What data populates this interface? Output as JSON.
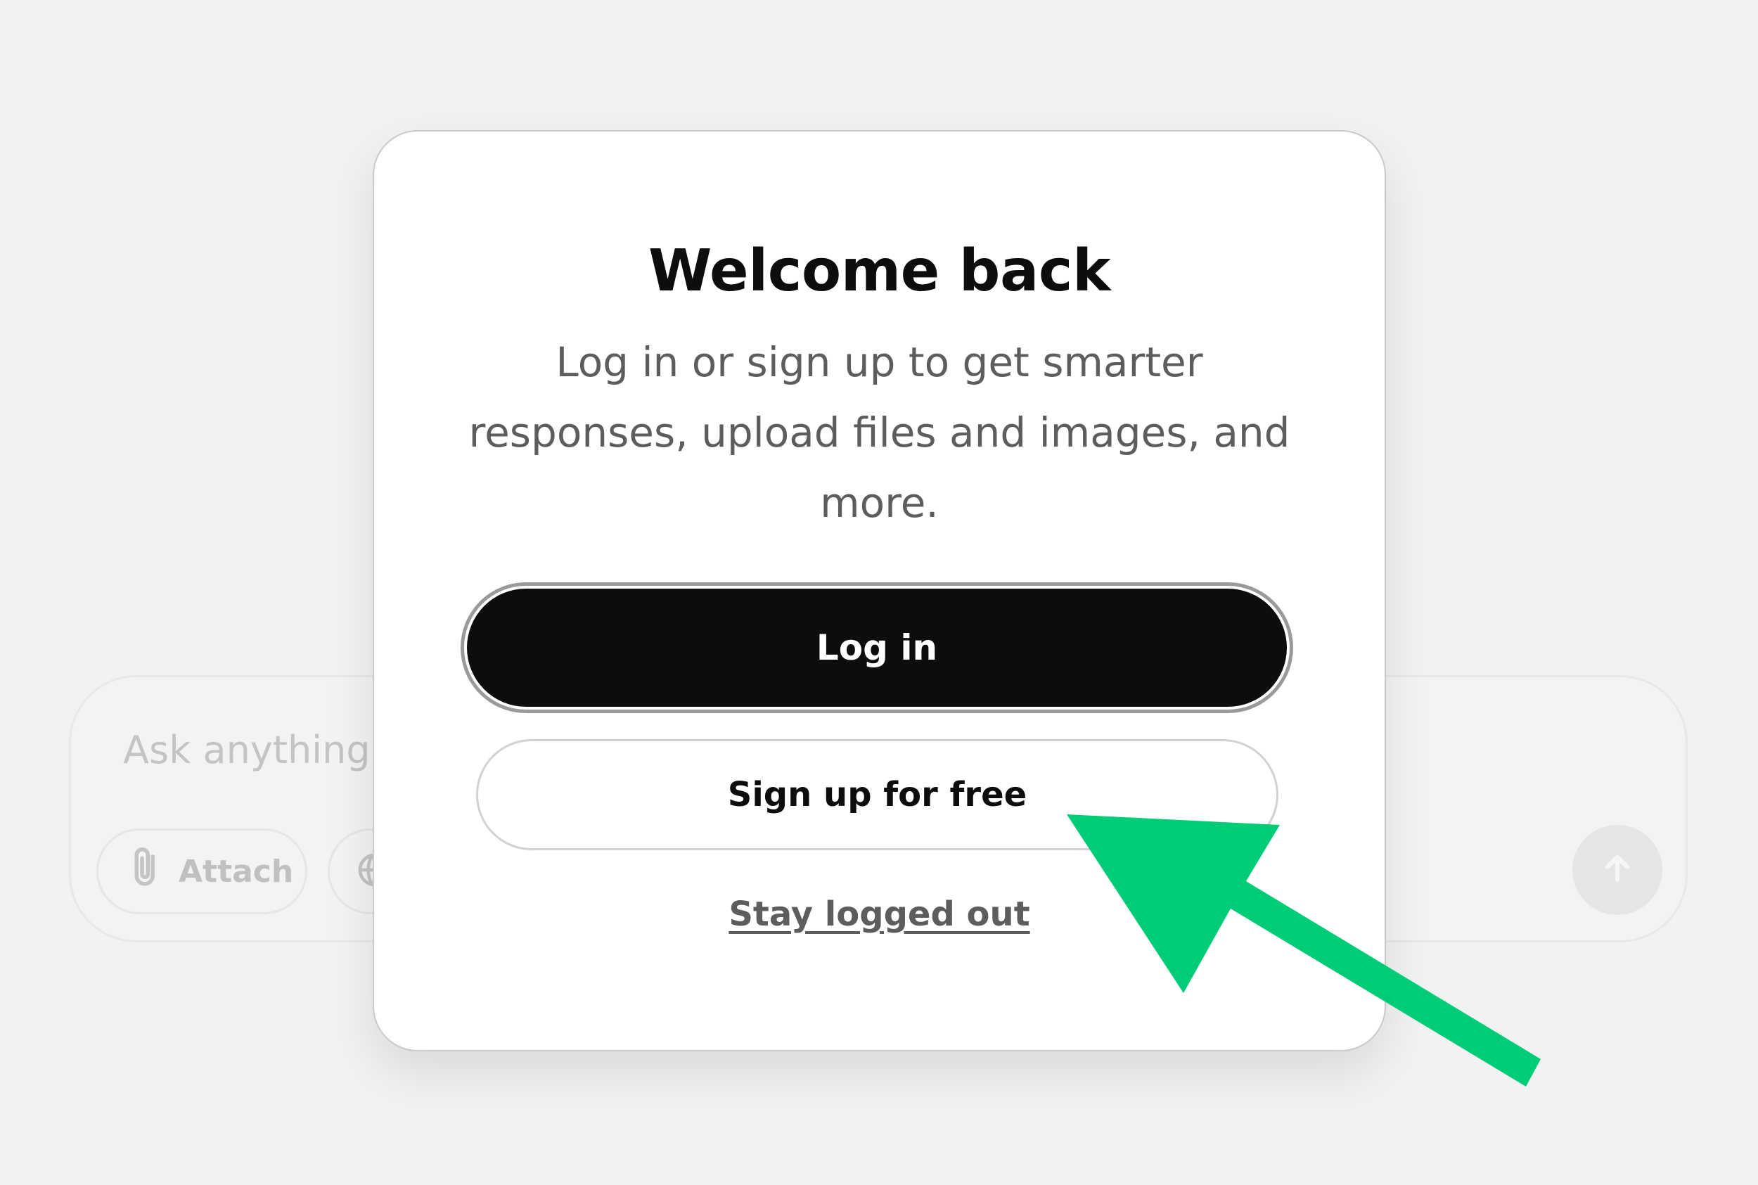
{
  "composer": {
    "placeholder": "Ask anything",
    "attach_label": "Attach"
  },
  "modal": {
    "title": "Welcome back",
    "subtitle_lines": [
      "Log in or sign up to get smarter",
      "responses, upload files and images, and",
      "more."
    ],
    "login_label": "Log in",
    "signup_label": "Sign up for free",
    "stay_logged_out_label": "Stay logged out"
  },
  "icons": {
    "attach": "paperclip-icon",
    "search": "globe-icon",
    "send": "arrow-up-icon",
    "annotation": "arrow-pointer-icon"
  },
  "colors": {
    "primary_button": "#0d0d0d",
    "annotation_arrow": "#00cc77",
    "background": "#f2f2f2"
  }
}
